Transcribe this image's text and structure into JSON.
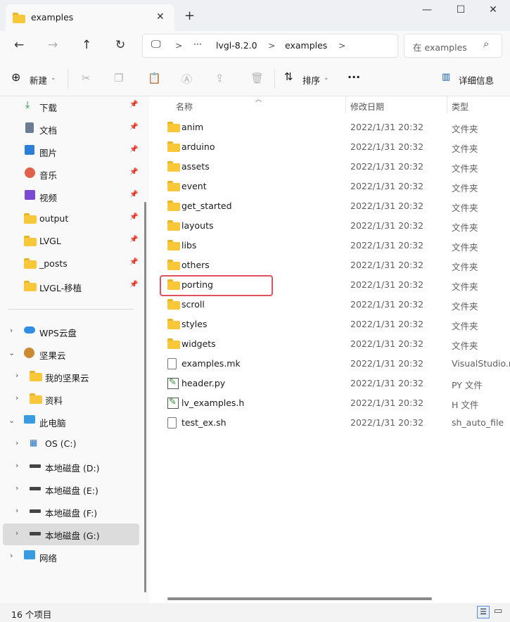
{
  "window": {
    "tab_title": "examples",
    "new_tab": "+",
    "close": "✕",
    "minimize": "—",
    "maximize": "☐",
    "window_close": "✕"
  },
  "address": {
    "computer": "🖵",
    "sep1": ">",
    "more": "···",
    "crumb1": "lvgl-8.2.0",
    "sep2": ">",
    "crumb2": "examples",
    "sep3": ">",
    "search_placeholder": "在 examples",
    "search_icon": "⌕"
  },
  "toolbar": {
    "new_label": "新建",
    "sort_label": "排序",
    "more": "···",
    "details_label": "详细信息"
  },
  "sidebar": {
    "quick": [
      {
        "label": "下载"
      },
      {
        "label": "文档"
      },
      {
        "label": "图片"
      },
      {
        "label": "音乐"
      },
      {
        "label": "视频"
      },
      {
        "label": "output"
      },
      {
        "label": "LVGL"
      },
      {
        "label": "_posts"
      },
      {
        "label": "LVGL-移植"
      }
    ],
    "tree": [
      {
        "label": "WPS云盘"
      },
      {
        "label": "坚果云"
      },
      {
        "label": "我的坚果云"
      },
      {
        "label": "资料"
      },
      {
        "label": "此电脑"
      },
      {
        "label": "OS (C:)"
      },
      {
        "label": "本地磁盘 (D:)"
      },
      {
        "label": "本地磁盘 (E:)"
      },
      {
        "label": "本地磁盘 (F:)"
      },
      {
        "label": "本地磁盘 (G:)"
      },
      {
        "label": "网络"
      }
    ]
  },
  "columns": {
    "name": "名称",
    "date": "修改日期",
    "type": "类型"
  },
  "files": [
    {
      "name": "anim",
      "date": "2022/1/31 20:32",
      "type": "文件夹",
      "kind": "folder"
    },
    {
      "name": "arduino",
      "date": "2022/1/31 20:32",
      "type": "文件夹",
      "kind": "folder"
    },
    {
      "name": "assets",
      "date": "2022/1/31 20:32",
      "type": "文件夹",
      "kind": "folder"
    },
    {
      "name": "event",
      "date": "2022/1/31 20:32",
      "type": "文件夹",
      "kind": "folder"
    },
    {
      "name": "get_started",
      "date": "2022/1/31 20:32",
      "type": "文件夹",
      "kind": "folder"
    },
    {
      "name": "layouts",
      "date": "2022/1/31 20:32",
      "type": "文件夹",
      "kind": "folder"
    },
    {
      "name": "libs",
      "date": "2022/1/31 20:32",
      "type": "文件夹",
      "kind": "folder"
    },
    {
      "name": "others",
      "date": "2022/1/31 20:32",
      "type": "文件夹",
      "kind": "folder"
    },
    {
      "name": "porting",
      "date": "2022/1/31 20:32",
      "type": "文件夹",
      "kind": "folder"
    },
    {
      "name": "scroll",
      "date": "2022/1/31 20:32",
      "type": "文件夹",
      "kind": "folder"
    },
    {
      "name": "styles",
      "date": "2022/1/31 20:32",
      "type": "文件夹",
      "kind": "folder"
    },
    {
      "name": "widgets",
      "date": "2022/1/31 20:32",
      "type": "文件夹",
      "kind": "folder"
    },
    {
      "name": "examples.mk",
      "date": "2022/1/31 20:32",
      "type": "VisualStudio.m",
      "kind": "file"
    },
    {
      "name": "header.py",
      "date": "2022/1/31 20:32",
      "type": "PY 文件",
      "kind": "script"
    },
    {
      "name": "lv_examples.h",
      "date": "2022/1/31 20:32",
      "type": "H 文件",
      "kind": "script"
    },
    {
      "name": "test_ex.sh",
      "date": "2022/1/31 20:32",
      "type": "sh_auto_file",
      "kind": "file"
    }
  ],
  "status": {
    "count": "16 个项目"
  }
}
